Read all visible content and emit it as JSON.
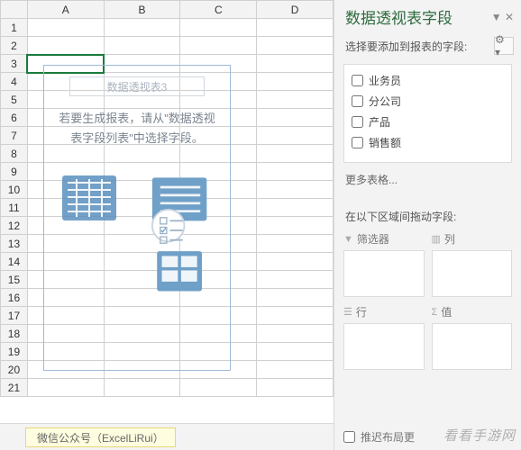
{
  "sheet": {
    "columns": [
      "A",
      "B",
      "C",
      "D"
    ],
    "rows": [
      1,
      2,
      3,
      4,
      5,
      6,
      7,
      8,
      9,
      10,
      11,
      12,
      13,
      14,
      15,
      16,
      17,
      18,
      19,
      20,
      21
    ],
    "selected_cell": "A3"
  },
  "pivot_placeholder": {
    "title": "数据透视表3",
    "message": "若要生成报表，请从\"数据透视表字段列表\"中选择字段。"
  },
  "pane": {
    "title": "数据透视表字段",
    "sub": "选择要添加到报表的字段:",
    "gear_icon": "gear",
    "close_icon": "close",
    "fields": [
      {
        "label": "业务员",
        "checked": false
      },
      {
        "label": "分公司",
        "checked": false
      },
      {
        "label": "产品",
        "checked": false
      },
      {
        "label": "销售额",
        "checked": false
      }
    ],
    "more": "更多表格...",
    "areas_label": "在以下区域间拖动字段:",
    "areas": {
      "filter": "筛选器",
      "columns": "列",
      "rows": "行",
      "values": "值"
    },
    "sigma": "Σ",
    "footer_checkbox": "推迟布局更",
    "footer_checked": false
  },
  "tabs": {
    "active": "微信公众号（ExcelLiRui）"
  },
  "watermark": "看看手游网"
}
